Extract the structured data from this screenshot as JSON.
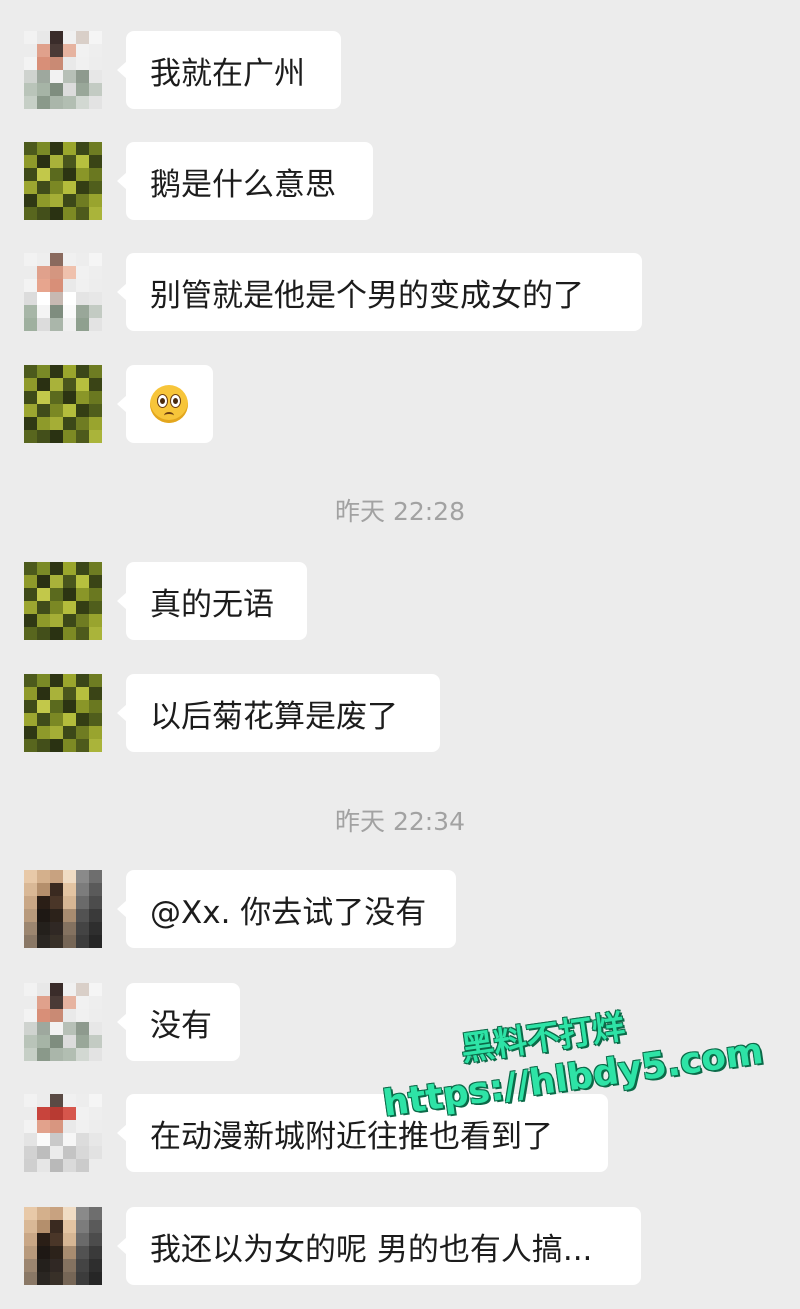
{
  "messages": [
    {
      "text": "我就在广州",
      "avatar": "avatar-a"
    },
    {
      "text": "鹅是什么意思",
      "avatar": "avatar-b"
    },
    {
      "text": "别管就是他是个男的变成女的了",
      "avatar": "avatar-a"
    },
    {
      "emoji": "flushed-face-emoji",
      "avatar": "avatar-b"
    },
    {
      "text": "真的无语",
      "avatar": "avatar-b"
    },
    {
      "text": "以后菊花算是废了",
      "avatar": "avatar-b"
    },
    {
      "text": "@Xx. 你去试了没有",
      "avatar": "avatar-c"
    },
    {
      "text": "没有",
      "avatar": "avatar-a"
    },
    {
      "text": "在动漫新城附近往推也看到了",
      "avatar": "avatar-d"
    },
    {
      "text": "我还以为女的呢 男的也有人搞...",
      "avatar": "avatar-c"
    }
  ],
  "timestamps": [
    "昨天 22:28",
    "昨天 22:34"
  ],
  "watermark": {
    "line1": "黑料不打烊",
    "line2": "https://hlbdy5.com"
  },
  "colors": {
    "background": "#ececec",
    "bubble": "#ffffff",
    "timestamp": "#a2a2a2",
    "watermark": "#2ee3a6"
  }
}
